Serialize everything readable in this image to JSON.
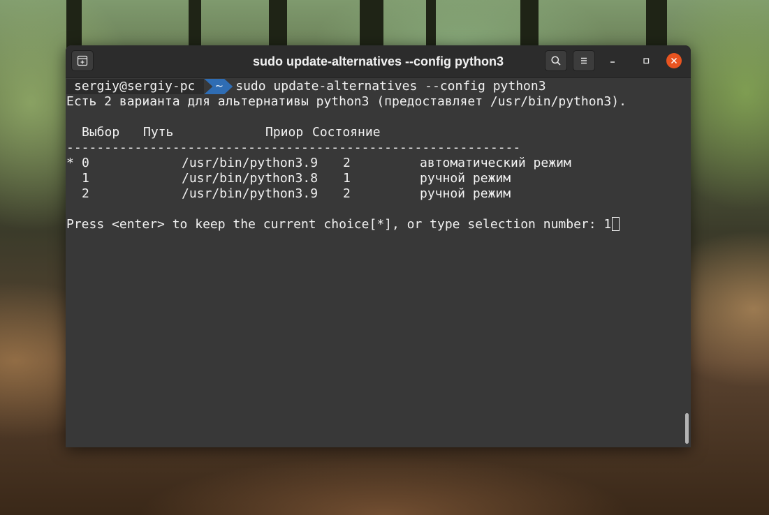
{
  "window": {
    "title": "sudo update-alternatives --config python3"
  },
  "terminal": {
    "prompt_user": "sergiy@sergiy-pc",
    "prompt_dir": "~",
    "command": "sudo update-alternatives --config python3",
    "info_line": "Есть 2 варианта для альтернативы python3 (предоставляет /usr/bin/python3).",
    "header": {
      "selection": "Выбор",
      "path": "Путь",
      "priority": "Приор",
      "status": "Состояние"
    },
    "separator": "------------------------------------------------------------",
    "rows": [
      {
        "marker": "*",
        "selection": "0",
        "path": "/usr/bin/python3.9",
        "priority": "2",
        "status": "автоматический режим"
      },
      {
        "marker": "",
        "selection": "1",
        "path": "/usr/bin/python3.8",
        "priority": "1",
        "status": "ручной режим"
      },
      {
        "marker": "",
        "selection": "2",
        "path": "/usr/bin/python3.9",
        "priority": "2",
        "status": "ручной режим"
      }
    ],
    "input_prompt": "Press <enter> to keep the current choice[*], or type selection number: ",
    "input_value": "1"
  },
  "colors": {
    "accent_close": "#e95420",
    "prompt_dir_bg": "#2f6db4",
    "terminal_bg": "#383838"
  },
  "icons": {
    "new_tab": "new-tab-icon",
    "search": "search-icon",
    "menu": "hamburger-menu-icon",
    "minimize": "minimize-icon",
    "maximize": "maximize-icon",
    "close": "close-icon"
  }
}
